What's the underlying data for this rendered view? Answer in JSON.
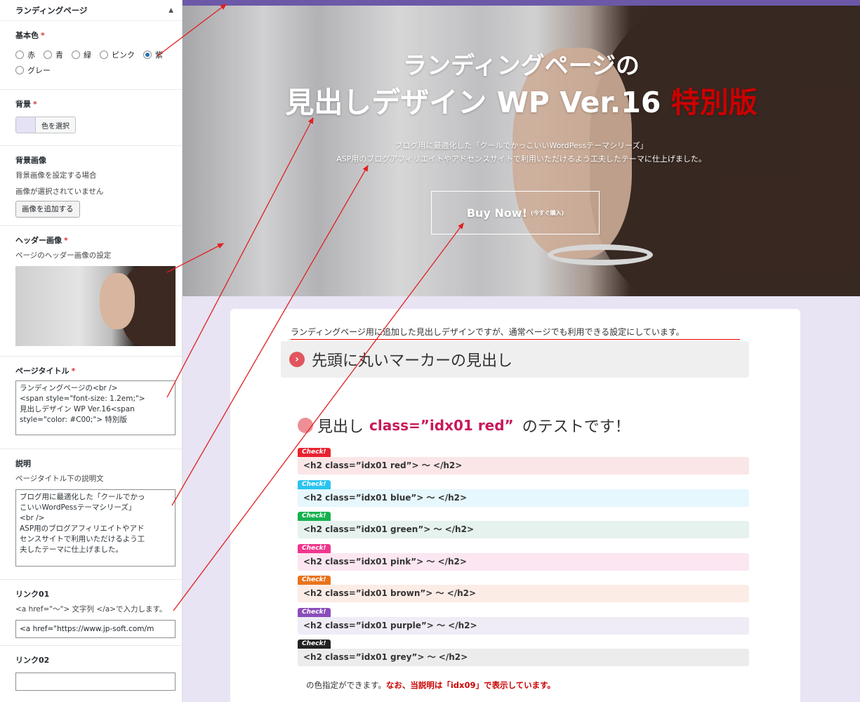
{
  "sidebar": {
    "section_title": "ランディングページ",
    "base_color": {
      "label": "基本色",
      "required": "*",
      "options": [
        "赤",
        "青",
        "緑",
        "ピンク",
        "紫",
        "グレー"
      ],
      "selected": "紫"
    },
    "background": {
      "label": "背景",
      "required": "*",
      "button": "色を選択",
      "swatch": "#e6e2f6"
    },
    "background_image": {
      "label": "背景画像",
      "desc": "背景画像を設定する場合",
      "status": "画像が選択されていません",
      "button": "画像を追加する"
    },
    "header_image": {
      "label": "ヘッダー画像",
      "required": "*",
      "desc": "ページのヘッダー画像の設定"
    },
    "page_title": {
      "label": "ページタイトル",
      "required": "*",
      "value": "ランディングページの<br />\n<span style=\"font-size: 1.2em;\">\n見出しデザイン WP Ver.16<span\nstyle=\"color: #C00;\"> 特別版"
    },
    "description": {
      "label": "説明",
      "desc": "ページタイトル下の説明文",
      "value": "ブログ用に最適化した「クールでかっ\nこいいWordPessテーマシリーズ」\n<br />\nASP用のブログアフィリエイトやアド\nセンスサイトで利用いただけるよう工\n夫したテーマに仕上げました。"
    },
    "link01": {
      "label": "リンク01",
      "desc": "<a href=\"〜\"> 文字列 </a>で入力します。",
      "value": "<a href=\"https://www.jp-soft.com/m"
    },
    "link02": {
      "label": "リンク02",
      "value": ""
    }
  },
  "hero": {
    "title_line1": "ランディングページの",
    "title_line2": "見出しデザイン WP Ver.16",
    "title_special": "特別版",
    "desc_line1": "ブログ用に最適化した「クールでかっこいいWordPessテーマシリーズ」",
    "desc_line2": "ASP用のブログアフィリエイトやアドセンスサイトで利用いただけるよう工夫したテーマに仕上げました。",
    "buy_label": "Buy Now!",
    "buy_sub": "(今すぐ購入)"
  },
  "content": {
    "intro": "ランディングページ用に追加した見出しデザインですが、通常ページでも利用できる設定にしています。",
    "marker_heading": "先頭に丸いマーカーの見出し",
    "marker_icon": "chevron-right-icon",
    "idx_heading_prefix": "見出し",
    "idx_heading_class": "class=”idx01 red”",
    "idx_heading_suffix": "のテストです！",
    "check_label": "Check!",
    "checks": [
      {
        "code": "<h2 class=”idx01 red”> 〜 </h2>",
        "tag_color": "#e8232f",
        "bg": "#fbe6e7"
      },
      {
        "code": "<h2 class=”idx01 blue”> 〜 </h2>",
        "tag_color": "#2cc4ee",
        "bg": "#e6f7fd"
      },
      {
        "code": "<h2 class=”idx01 green”> 〜 </h2>",
        "tag_color": "#16b14d",
        "bg": "#e6f2ee"
      },
      {
        "code": "<h2 class=”idx01 pink”> 〜 </h2>",
        "tag_color": "#f0368e",
        "bg": "#fbe6f1"
      },
      {
        "code": "<h2 class=”idx01 brown”> 〜 </h2>",
        "tag_color": "#e8741c",
        "bg": "#fcece6"
      },
      {
        "code": "<h2 class=”idx01 purple”> 〜 </h2>",
        "tag_color": "#8a4cba",
        "bg": "#efecf6"
      },
      {
        "code": "<h2 class=”idx01 grey”> 〜 </h2>",
        "tag_color": "#222222",
        "bg": "#ececec"
      }
    ],
    "note_plain": "の色指定ができます。",
    "note_red": "なお、当説明は「idx09」で表示しています。"
  },
  "colors": {
    "accent_bar": "#6b59a8",
    "page_bg": "#e8e4f3",
    "annotation_arrow": "#e02020"
  }
}
